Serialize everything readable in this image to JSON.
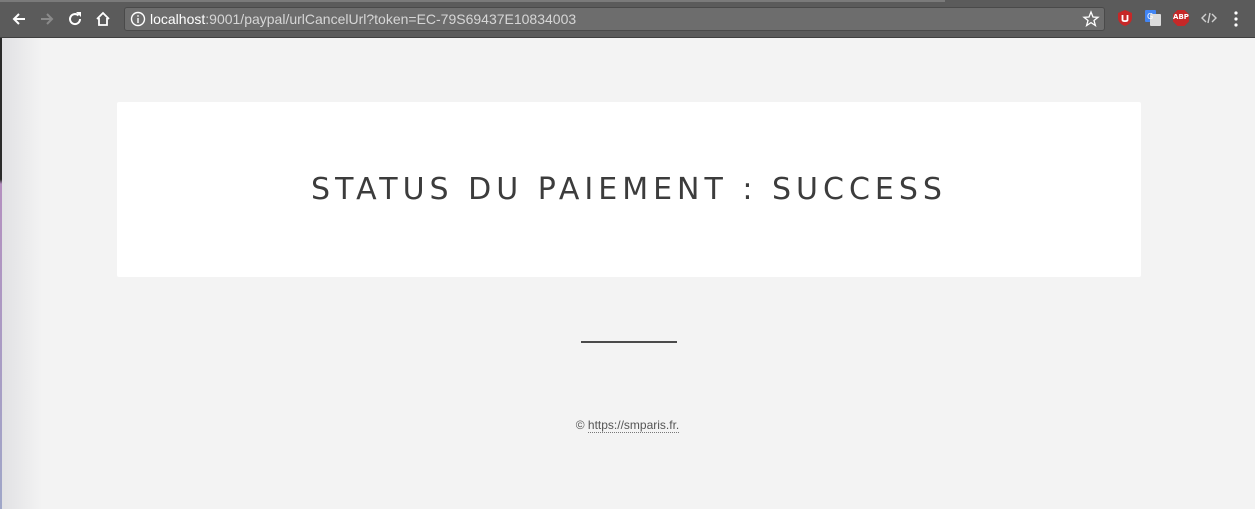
{
  "browser": {
    "url_host": "localhost",
    "url_path": ":9001/paypal/urlCancelUrl?token=EC-79S69437E10834003",
    "icons": {
      "back": "arrow-left-icon",
      "forward": "arrow-right-icon",
      "reload": "reload-icon",
      "home": "home-icon",
      "info": "info-icon",
      "bookmark": "star-icon",
      "menu": "kebab-menu-icon"
    },
    "extensions": {
      "ublock": "ublock-icon",
      "translate": "google-translate-icon",
      "abp_label": "ABP",
      "code": "code-icon"
    }
  },
  "page": {
    "status_title": "STATUS DU PAIEMENT : SUCCESS",
    "footer": {
      "copyright": "©",
      "link_text": "https://smparis.fr."
    }
  },
  "colors": {
    "toolbar": "#5b5b5b",
    "page_background": "#f3f3f3",
    "card": "#ffffff",
    "title_text": "#3c3c3c"
  }
}
